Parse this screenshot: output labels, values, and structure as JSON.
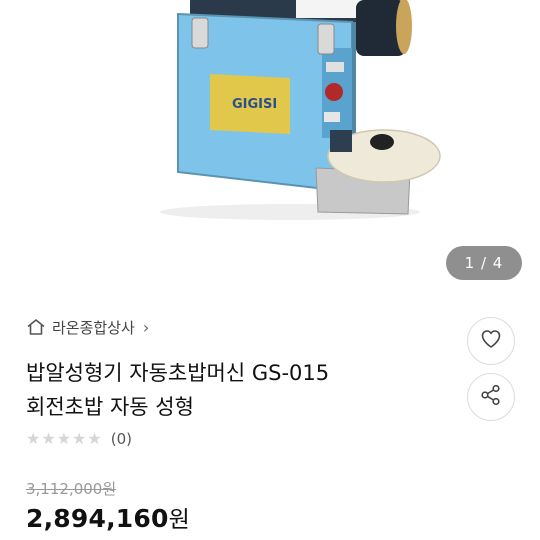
{
  "gallery": {
    "current": 1,
    "total": 4,
    "indicator": "1 / 4",
    "machine_logo_text": "GIGISI"
  },
  "seller": {
    "name": "라온종합상사",
    "chevron": "›",
    "icon": "home-icon"
  },
  "product": {
    "title_line1": "밥알성형기 자동초밥머신 GS-015",
    "title_line2": "회전초밥 자동 성형"
  },
  "actions": {
    "like_icon": "heart-icon",
    "share_icon": "share-icon"
  },
  "rating": {
    "stars_filled": 0,
    "stars_total": 5,
    "count_text": "(0)"
  },
  "price": {
    "original": "3,112,000원",
    "sale_amount": "2,894,160",
    "sale_unit": "원"
  },
  "colors": {
    "machine_body": "#7ec4ea",
    "badge_bg": "#8f8f8f",
    "star_empty": "#d6d6d6"
  }
}
